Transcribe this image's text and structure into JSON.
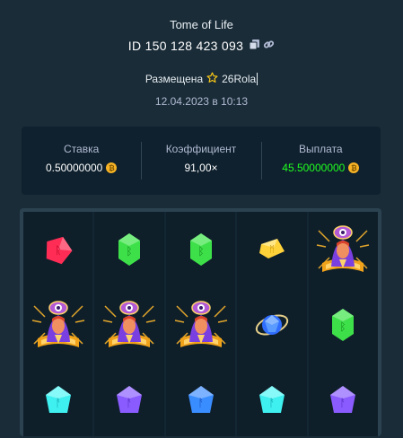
{
  "game": {
    "title": "Tome of Life",
    "id_label": "ID 150 128 423 093",
    "placed_label": "Размещена",
    "username": "26Rola",
    "date": "12.04.2023 в 10:13"
  },
  "stats": {
    "bet_label": "Ставка",
    "bet_value": "0.50000000",
    "multiplier_label": "Коэффициент",
    "multiplier_value": "91,00×",
    "payout_label": "Выплата",
    "payout_value": "45.50000000",
    "currency_icon": "bitcoin-coin-icon",
    "payout_color": "#1fff20"
  },
  "reels": [
    [
      "red-rune-gem",
      "sorceress-wild",
      "cyan-rune-gem"
    ],
    [
      "green-rune-gem",
      "sorceress-wild",
      "purple-rune-gem"
    ],
    [
      "green-rune-gem",
      "sorceress-wild",
      "blue-rune-gem"
    ],
    [
      "gold-rune-gem",
      "blue-orb-gem",
      "cyan-rune-gem"
    ],
    [
      "sorceress-wild",
      "green-rune-gem",
      "purple-rune-gem"
    ]
  ]
}
